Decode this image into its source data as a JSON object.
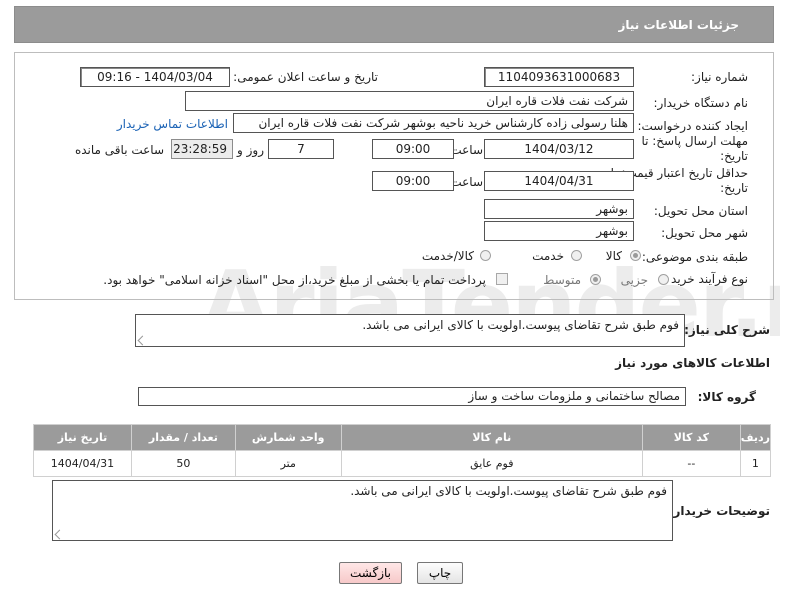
{
  "header": {
    "title": "جزئیات اطلاعات نیاز"
  },
  "watermark": {
    "text": "AriaTender.neT"
  },
  "form": {
    "need_number": {
      "label": "شماره نیاز:",
      "value": "1104093631000683"
    },
    "announce": {
      "label": "تاریخ و ساعت اعلان عمومی:",
      "value": "1404/03/04 - 09:16"
    },
    "buyer_org": {
      "label": "نام دستگاه خریدار:",
      "value": "شرکت نفت فلات قاره ایران"
    },
    "creator": {
      "label": "ایجاد کننده درخواست:",
      "value": "هلنا رسولی زاده کارشناس خرید ناحیه بوشهر  شرکت نفت فلات قاره ایران",
      "contact_link": "اطلاعات تماس خریدار"
    },
    "deadline": {
      "label": "مهلت ارسال پاسخ: تا تاریخ:",
      "date": "1404/03/12",
      "time_label": "ساعت",
      "time": "09:00",
      "days": "7",
      "days_label": "روز و",
      "remaining": "23:28:59",
      "remaining_label": "ساعت باقی مانده"
    },
    "min_validity": {
      "label": "حداقل تاریخ اعتبار قیمت: تا تاریخ:",
      "date": "1404/04/31",
      "time_label": "ساعت",
      "time": "09:00"
    },
    "province": {
      "label": "استان محل تحویل:",
      "value": "بوشهر"
    },
    "city": {
      "label": "شهر محل تحویل:",
      "value": "بوشهر"
    },
    "category": {
      "label": "طبقه بندی موضوعی:",
      "options": [
        "کالا",
        "خدمت",
        "کالا/خدمت"
      ],
      "selected": "کالا"
    },
    "process": {
      "label": "نوع فرآیند خرید :",
      "options": [
        "جزیی",
        "متوسط"
      ],
      "selected": "متوسط",
      "payment_note": "پرداخت تمام یا بخشی از مبلغ خرید،از محل \"اسناد خزانه اسلامی\" خواهد بود."
    }
  },
  "description": {
    "label": "شرح کلی نیاز:",
    "value": "فوم طبق شرح تقاضای پیوست.اولویت با کالای ایرانی می باشد."
  },
  "goods_section": {
    "title": "اطلاعات کالاهای مورد نیاز"
  },
  "goods_group": {
    "label": "گروه کالا:",
    "value": "مصالح ساختمانی و ملزومات ساخت و ساز"
  },
  "table": {
    "headers": [
      "ردیف",
      "کد کالا",
      "نام کالا",
      "واحد شمارش",
      "تعداد / مقدار",
      "تاریخ نیاز"
    ],
    "rows": [
      [
        "1",
        "--",
        "فوم عایق",
        "متر",
        "50",
        "1404/04/31"
      ]
    ]
  },
  "buyer_notes": {
    "label": "توضیحات خریدار:",
    "value": "فوم طبق شرح تقاضای پیوست.اولویت با کالای ایرانی می باشد."
  },
  "buttons": {
    "print": "چاپ",
    "back": "بازگشت"
  }
}
